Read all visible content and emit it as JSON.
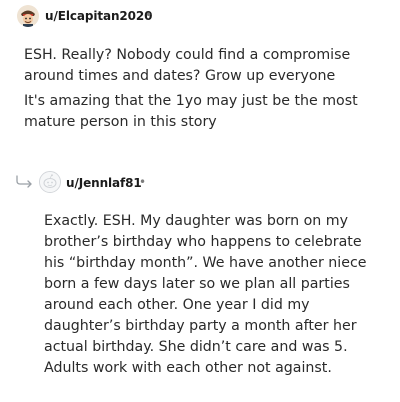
{
  "comments": [
    {
      "username": "u/Elcapitan2020",
      "separator": "•",
      "paragraphs": [
        "ESH. Really? Nobody could find a compromise around times and dates? Grow up everyone",
        "It's amazing that the 1yo may just be the most mature person in this story"
      ]
    },
    {
      "username": "u/Jennlaf81",
      "separator": "•",
      "paragraphs": [
        "Exactly. ESH. My daughter was born on my brother’s birthday who happens to celebrate his “birthday month”. We have another niece born a few days later so we plan all parties around each other. One year I did my daughter’s birthday party a month after her actual birthday. She didn’t care and was 5. Adults work with each other not against."
      ]
    }
  ],
  "icons": {
    "avatar_1": "cartoon-avatar-icon",
    "avatar_2": "default-snoo-avatar-icon",
    "reply": "reply-arrow-icon"
  }
}
